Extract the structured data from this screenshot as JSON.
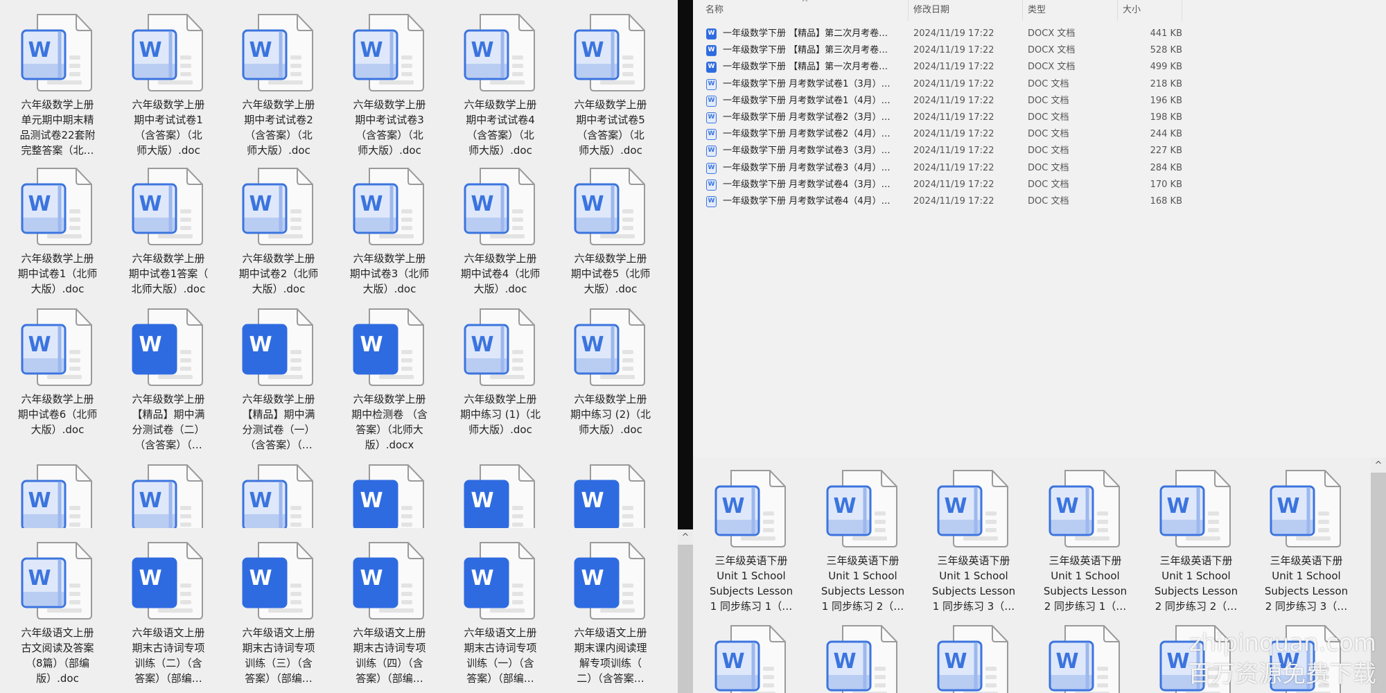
{
  "colors": {
    "accent": "#3b74de",
    "solid_icon": "#2f6be0",
    "light_icon_fill": "#dfe8fa"
  },
  "left_top": {
    "rows": [
      [
        {
          "label": "六年级数学上册\n单元期中期末精\n品测试卷22套附\n完整答案（北…",
          "icon": "light"
        },
        {
          "label": "六年级数学上册\n期中考试试卷1\n（含答案）（北\n师大版）.doc",
          "icon": "light"
        },
        {
          "label": "六年级数学上册\n期中考试试卷2\n（含答案）（北\n师大版）.doc",
          "icon": "light"
        },
        {
          "label": "六年级数学上册\n期中考试试卷3\n（含答案）（北\n师大版）.doc",
          "icon": "light"
        },
        {
          "label": "六年级数学上册\n期中考试试卷4\n（含答案）（北\n师大版）.doc",
          "icon": "light"
        },
        {
          "label": "六年级数学上册\n期中考试试卷5\n（含答案）（北\n师大版）.doc",
          "icon": "light"
        }
      ],
      [
        {
          "label": "六年级数学上册\n期中试卷1（北师\n大版）.doc",
          "icon": "light"
        },
        {
          "label": "六年级数学上册\n期中试卷1答案（\n北师大版）.doc",
          "icon": "light"
        },
        {
          "label": "六年级数学上册\n期中试卷2（北师\n大版）.doc",
          "icon": "light"
        },
        {
          "label": "六年级数学上册\n期中试卷3（北师\n大版）.doc",
          "icon": "light"
        },
        {
          "label": "六年级数学上册\n期中试卷4（北师\n大版）.doc",
          "icon": "light"
        },
        {
          "label": "六年级数学上册\n期中试卷5（北师\n大版）.doc",
          "icon": "light"
        }
      ],
      [
        {
          "label": "六年级数学上册\n期中试卷6（北师\n大版）.doc",
          "icon": "light"
        },
        {
          "label": "六年级数学上册\n【精品】期中满\n分测试卷（二）\n（含答案）（…",
          "icon": "solid"
        },
        {
          "label": "六年级数学上册\n【精品】期中满\n分测试卷（一）\n（含答案）（…",
          "icon": "solid"
        },
        {
          "label": "六年级数学上册\n期中检测卷 （含\n答案）（北师大\n版）.docx",
          "icon": "solid"
        },
        {
          "label": "六年级数学上册\n期中练习 (1)（北\n师大版）.doc",
          "icon": "light"
        },
        {
          "label": "六年级数学上册\n期中练习 (2)（北\n师大版）.doc",
          "icon": "light"
        }
      ],
      [
        {
          "icon": "light"
        },
        {
          "icon": "light"
        },
        {
          "icon": "light"
        },
        {
          "icon": "solid"
        },
        {
          "icon": "solid"
        },
        {
          "icon": "solid"
        }
      ]
    ]
  },
  "left_bottom": {
    "items": [
      {
        "label": "六年级语文上册\n古文阅读及答案\n（8篇）（部编\n版）.doc",
        "icon": "light"
      },
      {
        "label": "六年级语文上册\n期末古诗词专项\n训练（二）（含\n答案）（部编…",
        "icon": "solid"
      },
      {
        "label": "六年级语文上册\n期末古诗词专项\n训练（三）（含\n答案）（部编…",
        "icon": "solid"
      },
      {
        "label": "六年级语文上册\n期末古诗词专项\n训练（四）（含\n答案）（部编…",
        "icon": "solid"
      },
      {
        "label": "六年级语文上册\n期末古诗词专项\n训练（一）（含\n答案）（部编…",
        "icon": "solid"
      },
      {
        "label": "六年级语文上册\n期末课内阅读理\n解专项训练（\n二）（含答案…",
        "icon": "solid"
      }
    ]
  },
  "details": {
    "headers": {
      "name": "名称",
      "date": "修改日期",
      "type": "类型",
      "size": "大小"
    },
    "sort_indicator": "^",
    "rows": [
      {
        "name": "一年级数学下册 【精品】第二次月考卷…",
        "date": "2024/11/19 17:22",
        "type": "DOCX 文档",
        "size": "441 KB",
        "icon": "solid"
      },
      {
        "name": "一年级数学下册 【精品】第三次月考卷…",
        "date": "2024/11/19 17:22",
        "type": "DOCX 文档",
        "size": "528 KB",
        "icon": "solid"
      },
      {
        "name": "一年级数学下册 【精品】第一次月考卷…",
        "date": "2024/11/19 17:22",
        "type": "DOCX 文档",
        "size": "499 KB",
        "icon": "solid"
      },
      {
        "name": "一年级数学下册 月考数学试卷1（3月）…",
        "date": "2024/11/19 17:22",
        "type": "DOC 文档",
        "size": "218 KB",
        "icon": "light"
      },
      {
        "name": "一年级数学下册 月考数学试卷1（4月）…",
        "date": "2024/11/19 17:22",
        "type": "DOC 文档",
        "size": "196 KB",
        "icon": "light"
      },
      {
        "name": "一年级数学下册 月考数学试卷2（3月）…",
        "date": "2024/11/19 17:22",
        "type": "DOC 文档",
        "size": "198 KB",
        "icon": "light"
      },
      {
        "name": "一年级数学下册 月考数学试卷2（4月）…",
        "date": "2024/11/19 17:22",
        "type": "DOC 文档",
        "size": "244 KB",
        "icon": "light"
      },
      {
        "name": "一年级数学下册 月考数学试卷3（3月）…",
        "date": "2024/11/19 17:22",
        "type": "DOC 文档",
        "size": "227 KB",
        "icon": "light"
      },
      {
        "name": "一年级数学下册 月考数学试卷3（4月）…",
        "date": "2024/11/19 17:22",
        "type": "DOC 文档",
        "size": "284 KB",
        "icon": "light"
      },
      {
        "name": "一年级数学下册 月考数学试卷4（3月）…",
        "date": "2024/11/19 17:22",
        "type": "DOC 文档",
        "size": "170 KB",
        "icon": "light"
      },
      {
        "name": "一年级数学下册 月考数学试卷4（4月）…",
        "date": "2024/11/19 17:22",
        "type": "DOC 文档",
        "size": "168 KB",
        "icon": "light"
      }
    ]
  },
  "right_bottom": {
    "items": [
      {
        "label": "三年级英语下册\nUnit 1 School\nSubjects Lesson\n1 同步练习 1（…",
        "icon": "light"
      },
      {
        "label": "三年级英语下册\nUnit 1 School\nSubjects Lesson\n1 同步练习 2（…",
        "icon": "light"
      },
      {
        "label": "三年级英语下册\nUnit 1 School\nSubjects Lesson\n1 同步练习 3（…",
        "icon": "light"
      },
      {
        "label": "三年级英语下册\nUnit 1 School\nSubjects Lesson\n2 同步练习 1（…",
        "icon": "light"
      },
      {
        "label": "三年级英语下册\nUnit 1 School\nSubjects Lesson\n2 同步练习 2（…",
        "icon": "light"
      },
      {
        "label": "三年级英语下册\nUnit 1 School\nSubjects Lesson\n2 同步练习 3（…",
        "icon": "light"
      }
    ],
    "second_row": [
      {
        "icon": "light"
      },
      {
        "icon": "light"
      },
      {
        "icon": "light"
      },
      {
        "icon": "light"
      },
      {
        "icon": "light"
      },
      {
        "icon": "light"
      }
    ]
  },
  "scroll_up_glyph": "^",
  "watermark": {
    "domain": "zhipinquan.com",
    "slogan": "百万资源免费下载"
  }
}
